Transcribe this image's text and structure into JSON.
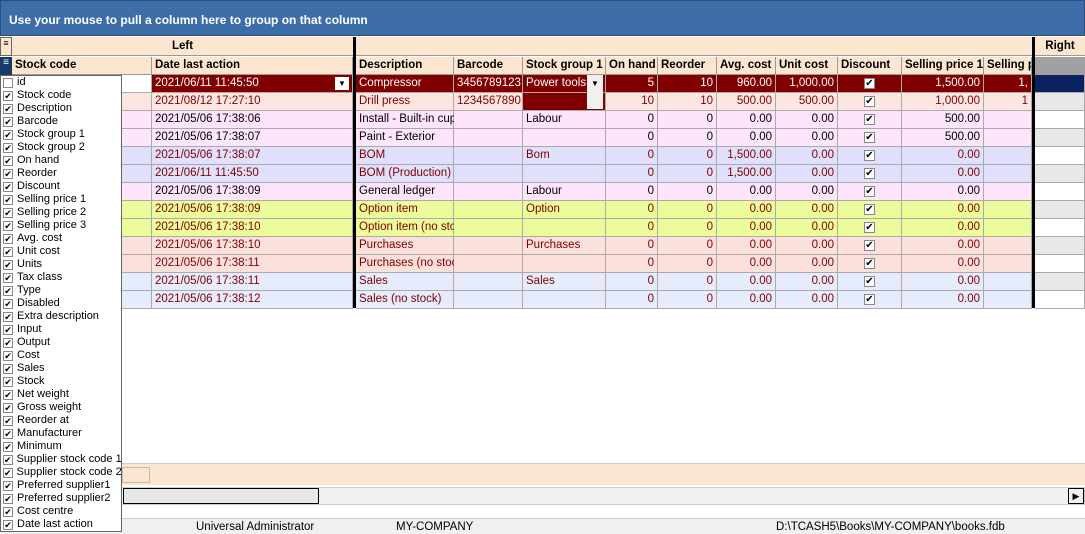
{
  "group_bar": "Use your mouse to pull a column here to group on that column",
  "bands": {
    "left": "Left",
    "right": "Right"
  },
  "columns": [
    "Stock code",
    "Date last action",
    "Description",
    "Barcode",
    "Stock group 1",
    "On hand",
    "Reorder",
    "Avg. cost",
    "Unit cost",
    "Discount",
    "Selling price 1",
    "Selling p"
  ],
  "rows": [
    {
      "date": "2021/06/11 11:45:50",
      "desc": "Compressor",
      "barcode": "3456789123",
      "group": "Power tools",
      "onhand": "5",
      "reorder": "10",
      "avg": "960.00",
      "unit": "1,000.00",
      "sp1": "1,500.00",
      "sp2": "1,",
      "selected": true
    },
    {
      "date": "2021/08/12 17:27:10",
      "desc": "Drill press",
      "barcode": "1234567890",
      "group": "",
      "onhand": "10",
      "reorder": "10",
      "avg": "500.00",
      "unit": "500.00",
      "sp1": "1,000.00",
      "sp2": "1"
    },
    {
      "date": "2021/05/06 17:38:06",
      "desc": "Install - Built-in cupbo",
      "barcode": "",
      "group": "Labour",
      "onhand": "0",
      "reorder": "0",
      "avg": "0.00",
      "unit": "0.00",
      "sp1": "500.00",
      "sp2": ""
    },
    {
      "date": "2021/05/06 17:38:07",
      "desc": "Paint - Exterior",
      "barcode": "",
      "group": "",
      "onhand": "0",
      "reorder": "0",
      "avg": "0.00",
      "unit": "0.00",
      "sp1": "500.00",
      "sp2": ""
    },
    {
      "date": "2021/05/06 17:38:07",
      "desc": "BOM",
      "barcode": "",
      "group": "Bom",
      "onhand": "0",
      "reorder": "0",
      "avg": "1,500.00",
      "unit": "0.00",
      "sp1": "0.00",
      "sp2": ""
    },
    {
      "date": "2021/06/11 11:45:50",
      "desc": "BOM (Production)",
      "barcode": "",
      "group": "",
      "onhand": "0",
      "reorder": "0",
      "avg": "1,500.00",
      "unit": "0.00",
      "sp1": "0.00",
      "sp2": ""
    },
    {
      "date": "2021/05/06 17:38:09",
      "desc": "General ledger",
      "barcode": "",
      "group": "Labour",
      "onhand": "0",
      "reorder": "0",
      "avg": "0.00",
      "unit": "0.00",
      "sp1": "0.00",
      "sp2": ""
    },
    {
      "date": "2021/05/06 17:38:09",
      "desc": "Option item",
      "barcode": "",
      "group": "Option",
      "onhand": "0",
      "reorder": "0",
      "avg": "0.00",
      "unit": "0.00",
      "sp1": "0.00",
      "sp2": ""
    },
    {
      "date": "2021/05/06 17:38:10",
      "desc": "Option item (no stock",
      "barcode": "",
      "group": "",
      "onhand": "0",
      "reorder": "0",
      "avg": "0.00",
      "unit": "0.00",
      "sp1": "0.00",
      "sp2": ""
    },
    {
      "date": "2021/05/06 17:38:10",
      "desc": "Purchases",
      "barcode": "",
      "group": "Purchases",
      "onhand": "0",
      "reorder": "0",
      "avg": "0.00",
      "unit": "0.00",
      "sp1": "0.00",
      "sp2": ""
    },
    {
      "date": "2021/05/06 17:38:11",
      "desc": "Purchases (no stock",
      "barcode": "",
      "group": "",
      "onhand": "0",
      "reorder": "0",
      "avg": "0.00",
      "unit": "0.00",
      "sp1": "0.00",
      "sp2": ""
    },
    {
      "date": "2021/05/06 17:38:11",
      "desc": "Sales",
      "barcode": "",
      "group": "Sales",
      "onhand": "0",
      "reorder": "0",
      "avg": "0.00",
      "unit": "0.00",
      "sp1": "0.00",
      "sp2": ""
    },
    {
      "date": "2021/05/06 17:38:12",
      "desc": "Sales (no stock)",
      "barcode": "",
      "group": "",
      "onhand": "0",
      "reorder": "0",
      "avg": "0.00",
      "unit": "0.00",
      "sp1": "0.00",
      "sp2": ""
    }
  ],
  "row_styles": [
    {
      "bg": "#800000",
      "fg": "#ffffff"
    },
    {
      "bg": "#fde6e2",
      "fg": "#800000"
    },
    {
      "bg": "#fde6fc",
      "fg": "#000000"
    },
    {
      "bg": "#fde6fc",
      "fg": "#000000"
    },
    {
      "bg": "#e0e0fc",
      "fg": "#800000"
    },
    {
      "bg": "#e0e0fc",
      "fg": "#800000"
    },
    {
      "bg": "#fde6fc",
      "fg": "#000000"
    },
    {
      "bg": "#ecfc9c",
      "fg": "#800000"
    },
    {
      "bg": "#ecfc9c",
      "fg": "#800000"
    },
    {
      "bg": "#fbe0dc",
      "fg": "#800000"
    },
    {
      "bg": "#fbe0dc",
      "fg": "#800000"
    },
    {
      "bg": "#e6ecfc",
      "fg": "#800000"
    },
    {
      "bg": "#e6ecfc",
      "fg": "#800000"
    }
  ],
  "column_chooser": [
    {
      "label": "id",
      "checked": false
    },
    {
      "label": "Stock code",
      "checked": true
    },
    {
      "label": "Description",
      "checked": true
    },
    {
      "label": "Barcode",
      "checked": true
    },
    {
      "label": "Stock group 1",
      "checked": true
    },
    {
      "label": "Stock group 2",
      "checked": true
    },
    {
      "label": "On hand",
      "checked": true
    },
    {
      "label": "Reorder",
      "checked": true
    },
    {
      "label": "Discount",
      "checked": true
    },
    {
      "label": "Selling price 1",
      "checked": true
    },
    {
      "label": "Selling price 2",
      "checked": true
    },
    {
      "label": "Selling price 3",
      "checked": true
    },
    {
      "label": "Avg. cost",
      "checked": true
    },
    {
      "label": "Unit cost",
      "checked": true
    },
    {
      "label": "Units",
      "checked": true
    },
    {
      "label": "Tax class",
      "checked": true
    },
    {
      "label": "Type",
      "checked": true
    },
    {
      "label": "Disabled",
      "checked": true
    },
    {
      "label": "Extra description",
      "checked": true
    },
    {
      "label": "Input",
      "checked": true
    },
    {
      "label": "Output",
      "checked": true
    },
    {
      "label": "Cost",
      "checked": true
    },
    {
      "label": "Sales",
      "checked": true
    },
    {
      "label": "Stock",
      "checked": true
    },
    {
      "label": "Net weight",
      "checked": true
    },
    {
      "label": "Gross weight",
      "checked": true
    },
    {
      "label": "Reorder at",
      "checked": true
    },
    {
      "label": "Manufacturer",
      "checked": true
    },
    {
      "label": "Minimum",
      "checked": true
    },
    {
      "label": "Supplier stock code 1",
      "checked": true
    },
    {
      "label": "Supplier stock code 2",
      "checked": true
    },
    {
      "label": "Preferred supplier1",
      "checked": true
    },
    {
      "label": "Preferred supplier2",
      "checked": true
    },
    {
      "label": "Cost centre",
      "checked": true
    },
    {
      "label": "Date last action",
      "checked": true
    }
  ],
  "status": {
    "user": "Universal Administrator",
    "company": "MY-COMPANY",
    "path": "D:\\TCASH5\\Books\\MY-COMPANY\\books.fdb"
  }
}
